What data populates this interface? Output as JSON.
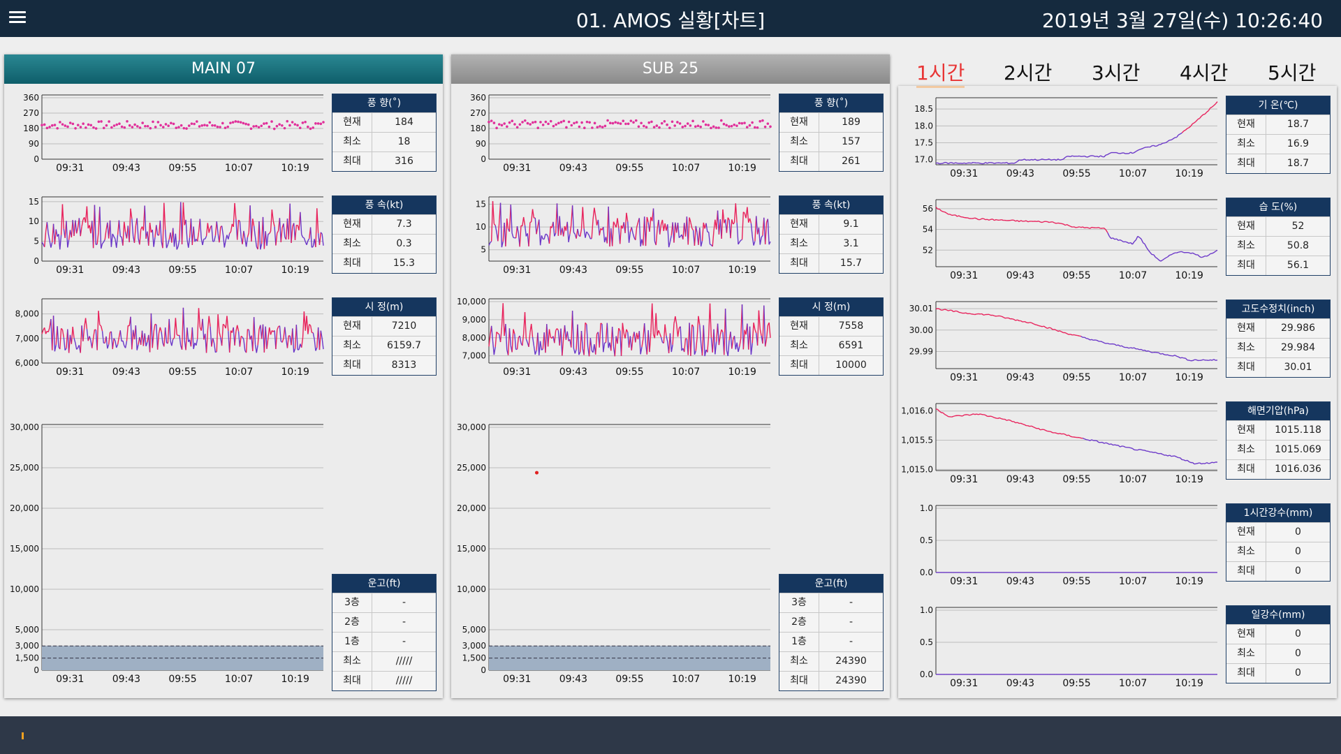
{
  "header": {
    "title": "01. AMOS 실황[차트]",
    "datetime": "2019년 3월 27일(수) 10:26:40"
  },
  "colors": {
    "header_bg": "#152a3e",
    "panel_main": "#17707c",
    "panel_sub": "#999999",
    "stat_title": "#15365e",
    "active_tab": "#e83535",
    "series_high": "#e8205a",
    "series_low": "#6a36c8",
    "point": "#e0309a"
  },
  "tabs": [
    "1시간",
    "2시간",
    "3시간",
    "4시간",
    "5시간"
  ],
  "active_tab": "1시간",
  "panels": [
    {
      "name": "MAIN 07",
      "wind_dir": {
        "title": "풍 향(˚)",
        "rows": [
          [
            "현재",
            "184"
          ],
          [
            "최소",
            "18"
          ],
          [
            "최대",
            "316"
          ]
        ]
      },
      "wind_speed": {
        "title": "풍 속(kt)",
        "rows": [
          [
            "현재",
            "7.3"
          ],
          [
            "최소",
            "0.3"
          ],
          [
            "최대",
            "15.3"
          ]
        ]
      },
      "visibility": {
        "title": "시 정(m)",
        "rows": [
          [
            "현재",
            "7210"
          ],
          [
            "최소",
            "6159.7"
          ],
          [
            "최대",
            "8313"
          ]
        ]
      },
      "cloud": {
        "title": "운고(ft)",
        "rows": [
          [
            "3층",
            "-"
          ],
          [
            "2층",
            "-"
          ],
          [
            "1층",
            "-"
          ],
          [
            "최소",
            "/////"
          ],
          [
            "최대",
            "/////"
          ]
        ]
      }
    },
    {
      "name": "SUB 25",
      "wind_dir": {
        "title": "풍 향(˚)",
        "rows": [
          [
            "현재",
            "189"
          ],
          [
            "최소",
            "157"
          ],
          [
            "최대",
            "261"
          ]
        ]
      },
      "wind_speed": {
        "title": "풍 속(kt)",
        "rows": [
          [
            "현재",
            "9.1"
          ],
          [
            "최소",
            "3.1"
          ],
          [
            "최대",
            "15.7"
          ]
        ]
      },
      "visibility": {
        "title": "시 정(m)",
        "rows": [
          [
            "현재",
            "7558"
          ],
          [
            "최소",
            "6591"
          ],
          [
            "최대",
            "10000"
          ]
        ]
      },
      "cloud": {
        "title": "운고(ft)",
        "rows": [
          [
            "3층",
            "-"
          ],
          [
            "2층",
            "-"
          ],
          [
            "1층",
            "-"
          ],
          [
            "최소",
            "24390"
          ],
          [
            "최대",
            "24390"
          ]
        ]
      }
    }
  ],
  "right": [
    {
      "title": "기 온(℃)",
      "rows": [
        [
          "현재",
          "18.7"
        ],
        [
          "최소",
          "16.9"
        ],
        [
          "최대",
          "18.7"
        ]
      ]
    },
    {
      "title": "습 도(%)",
      "rows": [
        [
          "현재",
          "52"
        ],
        [
          "최소",
          "50.8"
        ],
        [
          "최대",
          "56.1"
        ]
      ]
    },
    {
      "title": "고도수정치(inch)",
      "rows": [
        [
          "현재",
          "29.986"
        ],
        [
          "최소",
          "29.984"
        ],
        [
          "최대",
          "30.01"
        ]
      ]
    },
    {
      "title": "해면기압(hPa)",
      "rows": [
        [
          "현재",
          "1015.118"
        ],
        [
          "최소",
          "1015.069"
        ],
        [
          "최대",
          "1016.036"
        ]
      ]
    },
    {
      "title": "1시간강수(mm)",
      "rows": [
        [
          "현재",
          "0"
        ],
        [
          "최소",
          "0"
        ],
        [
          "최대",
          "0"
        ]
      ]
    },
    {
      "title": "일강수(mm)",
      "rows": [
        [
          "현재",
          "0"
        ],
        [
          "최소",
          "0"
        ],
        [
          "최대",
          "0"
        ]
      ]
    }
  ],
  "chart_data": [
    {
      "id": "main-wind-dir",
      "type": "scatter",
      "x_ticks": [
        "09:31",
        "09:43",
        "09:55",
        "10:07",
        "10:19"
      ],
      "y_ticks": [
        "0",
        "90",
        "180",
        "270",
        "360"
      ],
      "ylim": [
        0,
        360
      ],
      "series_mean": 200,
      "series_range": [
        150,
        250
      ],
      "gridlines": true
    },
    {
      "id": "main-wind-speed",
      "type": "line",
      "x_ticks": [
        "09:31",
        "09:43",
        "09:55",
        "10:07",
        "10:19"
      ],
      "y_ticks": [
        "0",
        "5",
        "10",
        "15"
      ],
      "ylim": [
        0,
        15.5
      ],
      "series_mean": 7,
      "series_range": [
        0.3,
        15.3
      ],
      "gridlines": true
    },
    {
      "id": "main-visibility",
      "type": "line",
      "x_ticks": [
        "09:31",
        "09:43",
        "09:55",
        "10:07",
        "10:19"
      ],
      "y_ticks": [
        "6,000",
        "7,000",
        "8,000"
      ],
      "ylim": [
        6000,
        8500
      ],
      "series_mean": 7000,
      "series_range": [
        6160,
        8313
      ],
      "gridlines": true
    },
    {
      "id": "main-cloud",
      "type": "area",
      "x_ticks": [
        "09:31",
        "09:43",
        "09:55",
        "10:07",
        "10:19"
      ],
      "y_ticks": [
        "0",
        "1,500",
        "3,000",
        "5,000",
        "10,000",
        "15,000",
        "20,000",
        "25,000",
        "30,000"
      ],
      "ylim": [
        0,
        30000
      ],
      "band": [
        0,
        3000
      ],
      "gridlines": true
    },
    {
      "id": "sub-wind-dir",
      "type": "scatter",
      "x_ticks": [
        "09:31",
        "09:43",
        "09:55",
        "10:07",
        "10:19"
      ],
      "y_ticks": [
        "0",
        "90",
        "180",
        "270",
        "360"
      ],
      "ylim": [
        0,
        360
      ],
      "series_mean": 205,
      "series_range": [
        160,
        260
      ],
      "gridlines": true
    },
    {
      "id": "sub-wind-speed",
      "type": "line",
      "x_ticks": [
        "09:31",
        "09:43",
        "09:55",
        "10:07",
        "10:19"
      ],
      "y_ticks": [
        "5",
        "10",
        "15"
      ],
      "ylim": [
        2.5,
        16
      ],
      "series_mean": 9,
      "series_range": [
        3.1,
        15.7
      ],
      "gridlines": true
    },
    {
      "id": "sub-visibility",
      "type": "line",
      "x_ticks": [
        "09:31",
        "09:43",
        "09:55",
        "10:07",
        "10:19"
      ],
      "y_ticks": [
        "7,000",
        "8,000",
        "9,000",
        "10,000"
      ],
      "ylim": [
        6600,
        10000
      ],
      "series_mean": 7900,
      "series_range": [
        6591,
        10000
      ],
      "gridlines": true
    },
    {
      "id": "sub-cloud",
      "type": "area",
      "x_ticks": [
        "09:31",
        "09:43",
        "09:55",
        "10:07",
        "10:19"
      ],
      "y_ticks": [
        "0",
        "1,500",
        "3,000",
        "5,000",
        "10,000",
        "15,000",
        "20,000",
        "25,000",
        "30,000"
      ],
      "ylim": [
        0,
        30000
      ],
      "band": [
        0,
        3000
      ],
      "points": [
        [
          0.17,
          24390
        ]
      ],
      "gridlines": true
    },
    {
      "id": "temperature",
      "type": "line",
      "x_ticks": [
        "09:31",
        "09:43",
        "09:55",
        "10:07",
        "10:19"
      ],
      "y_ticks": [
        "17.0",
        "17.5",
        "18.0",
        "18.5"
      ],
      "ylim": [
        16.85,
        18.75
      ],
      "trend": [
        [
          0,
          16.9
        ],
        [
          0.28,
          16.9
        ],
        [
          0.3,
          17.0
        ],
        [
          0.45,
          17.0
        ],
        [
          0.47,
          17.1
        ],
        [
          0.6,
          17.1
        ],
        [
          0.62,
          17.2
        ],
        [
          0.7,
          17.2
        ],
        [
          0.72,
          17.3
        ],
        [
          0.8,
          17.45
        ],
        [
          0.86,
          17.7
        ],
        [
          0.92,
          18.1
        ],
        [
          1.0,
          18.7
        ]
      ]
    },
    {
      "id": "humidity",
      "type": "line",
      "x_ticks": [
        "09:31",
        "09:43",
        "09:55",
        "10:07",
        "10:19"
      ],
      "y_ticks": [
        "52",
        "54",
        "56"
      ],
      "ylim": [
        50.4,
        56.6
      ],
      "trend": [
        [
          0,
          56.1
        ],
        [
          0.05,
          55.4
        ],
        [
          0.15,
          55.0
        ],
        [
          0.3,
          54.8
        ],
        [
          0.42,
          54.7
        ],
        [
          0.5,
          54.2
        ],
        [
          0.6,
          54.1
        ],
        [
          0.62,
          53.2
        ],
        [
          0.7,
          52.6
        ],
        [
          0.72,
          53.4
        ],
        [
          0.76,
          51.8
        ],
        [
          0.8,
          50.9
        ],
        [
          0.85,
          51.8
        ],
        [
          0.9,
          51.8
        ],
        [
          0.95,
          51.3
        ],
        [
          1.0,
          52.0
        ]
      ]
    },
    {
      "id": "altimeter",
      "type": "line",
      "x_ticks": [
        "09:31",
        "09:43",
        "09:55",
        "10:07",
        "10:19"
      ],
      "y_ticks": [
        "29.99",
        "30.00",
        "30.01"
      ],
      "ylim": [
        29.982,
        30.012
      ],
      "trend": [
        [
          0,
          30.01
        ],
        [
          0.1,
          30.008
        ],
        [
          0.2,
          30.007
        ],
        [
          0.35,
          30.003
        ],
        [
          0.45,
          29.999
        ],
        [
          0.6,
          29.994
        ],
        [
          0.72,
          29.991
        ],
        [
          0.8,
          29.989
        ],
        [
          0.85,
          29.988
        ],
        [
          0.9,
          29.986
        ],
        [
          1.0,
          29.986
        ]
      ]
    },
    {
      "id": "sea-level-pressure",
      "type": "line",
      "x_ticks": [
        "09:31",
        "09:43",
        "09:55",
        "10:07",
        "10:19"
      ],
      "y_ticks": [
        "1,015.0",
        "1,015.5",
        "1,016.0"
      ],
      "ylim": [
        1014.98,
        1016.08
      ],
      "trend": [
        [
          0,
          1016.036
        ],
        [
          0.05,
          1015.9
        ],
        [
          0.15,
          1015.95
        ],
        [
          0.25,
          1015.85
        ],
        [
          0.4,
          1015.65
        ],
        [
          0.55,
          1015.5
        ],
        [
          0.7,
          1015.35
        ],
        [
          0.85,
          1015.22
        ],
        [
          0.92,
          1015.1
        ],
        [
          1.0,
          1015.118
        ]
      ]
    },
    {
      "id": "rain-1h",
      "type": "line",
      "x_ticks": [
        "09:31",
        "09:43",
        "09:55",
        "10:07",
        "10:19"
      ],
      "y_ticks": [
        "0.0",
        "0.5",
        "1.0"
      ],
      "ylim": [
        0,
        1
      ],
      "trend": [
        [
          0,
          0
        ],
        [
          1,
          0
        ]
      ]
    },
    {
      "id": "rain-daily",
      "type": "line",
      "x_ticks": [
        "09:31",
        "09:43",
        "09:55",
        "10:07",
        "10:19"
      ],
      "y_ticks": [
        "0.0",
        "0.5",
        "1.0"
      ],
      "ylim": [
        0,
        1
      ],
      "trend": [
        [
          0,
          0
        ],
        [
          1,
          0
        ]
      ]
    }
  ]
}
